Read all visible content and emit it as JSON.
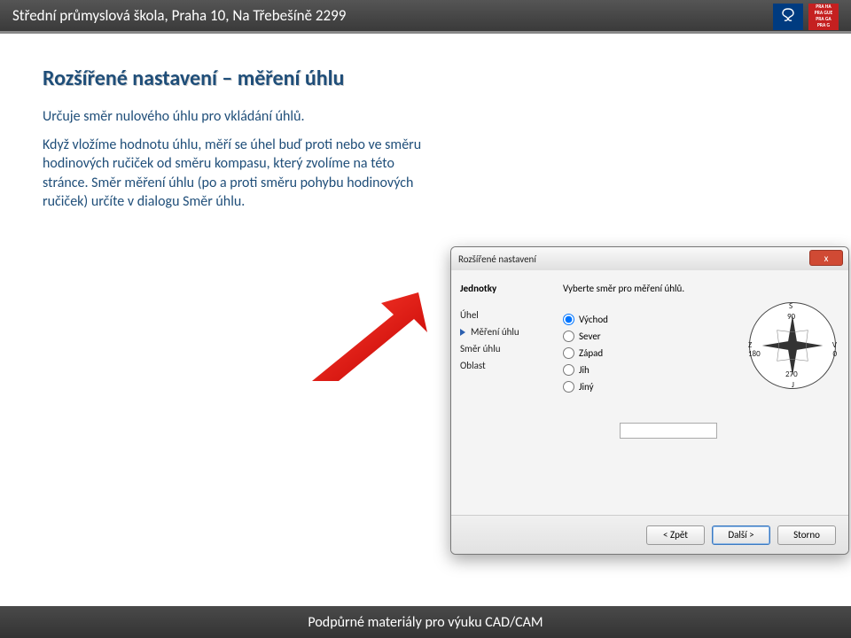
{
  "topbar": {
    "school": "Střední průmyslová škola, Praha 10, Na Třebešíně 2299",
    "logo_sps": "SPŠ",
    "logo_prg": "PRA HA\nPRA GUE\nPRA GA\nPRA G"
  },
  "page": {
    "title": "Rozšířené nastavení – měření úhlu",
    "p1": "Určuje směr nulového úhlu pro vkládání úhlů.",
    "p2": "Když vložíme hodnotu úhlu, měří se úhel buď proti nebo ve směru hodinových ručiček od směru kompasu, který zvolíme na této stránce. Směr měření úhlu (po a proti směru pohybu hodinových ručiček) určíte v dialogu Směr úhlu."
  },
  "dialog": {
    "title": "Rozšířené nastavení",
    "close": "x",
    "side_header": "Jednotky",
    "side_items": [
      "Úhel",
      "Měření úhlu",
      "Směr úhlu",
      "Oblast"
    ],
    "instruction": "Vyberte směr pro měření úhlů.",
    "options": [
      "Východ",
      "Sever",
      "Západ",
      "Jih",
      "Jiný"
    ],
    "selected_index": 0,
    "input_value": "",
    "compass": {
      "top": "S",
      "bottom": "J",
      "left": "Z",
      "left2": "180",
      "right": "V",
      "right2": "0",
      "n90": "90",
      "n270": "270"
    },
    "buttons": {
      "back": "< Zpět",
      "next": "Další >",
      "cancel": "Storno"
    }
  },
  "footer": "Podpůrné materiály pro výuku CAD/CAM"
}
